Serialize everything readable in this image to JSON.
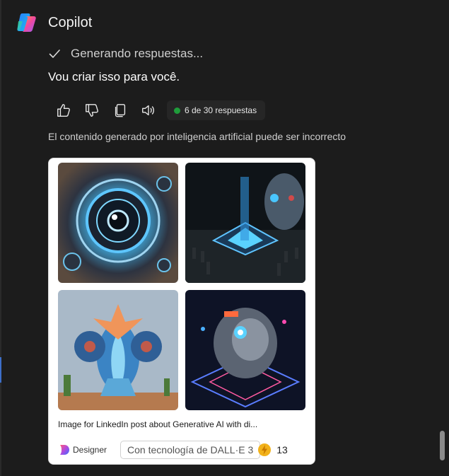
{
  "app": {
    "title": "Copilot"
  },
  "status": {
    "text": "Generando respuestas..."
  },
  "message": {
    "text": "Vou criar isso para você."
  },
  "actions": {
    "like": "thumbs-up-icon",
    "dislike": "thumbs-down-icon",
    "copy": "copy-icon",
    "read_aloud": "speaker-icon",
    "counter_label": "6 de 30 respuestas"
  },
  "disclaimer": "El contenido generado por inteligencia artificial puede ser incorrecto",
  "image_card": {
    "images": [
      "generated-image-1",
      "generated-image-2",
      "generated-image-3",
      "generated-image-4"
    ],
    "caption": "Image for LinkedIn post about Generative AI with di...",
    "designer_label": "Designer",
    "powered_by": "Con tecnología de DALL·E 3",
    "boost_count": "13"
  },
  "colors": {
    "background": "#1c1c1c",
    "card": "#ffffff",
    "status_dot": "#1f9d3b",
    "boost": "#f2b21b"
  }
}
